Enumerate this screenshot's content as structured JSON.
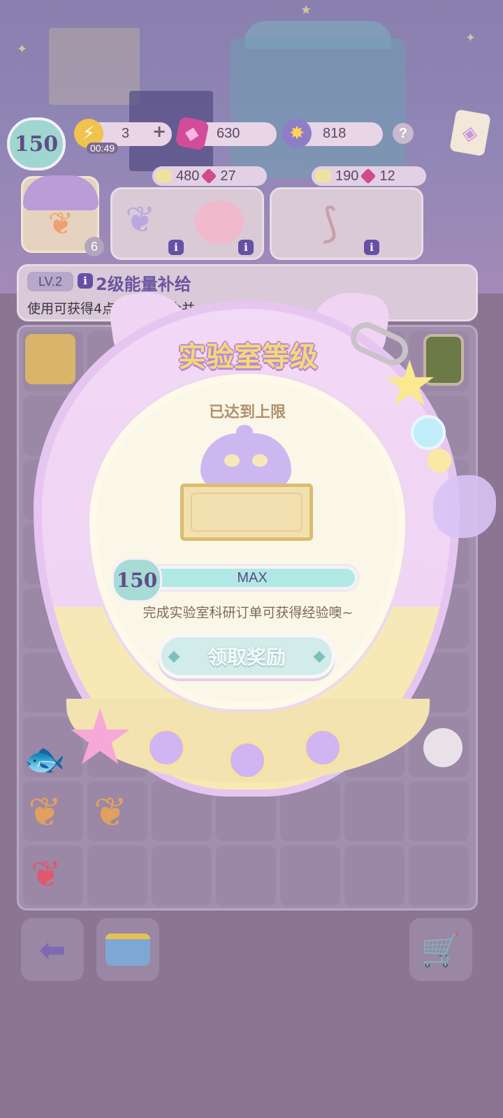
{
  "hud": {
    "level": "150",
    "energy": "3",
    "energy_timer": "00:49",
    "energy_add": "+",
    "gems": "630",
    "stars": "818",
    "help": "?"
  },
  "shop_slots": [
    {
      "ticket": "480",
      "gems": "27"
    },
    {
      "ticket": "190",
      "gems": "12"
    }
  ],
  "selected_item": {
    "count": "6"
  },
  "info_label": "i",
  "description": {
    "level_tag": "LV.2",
    "title": "2级能量补给",
    "text": "使用可获得4点能量值。合并..."
  },
  "popup": {
    "title": "实验室等级",
    "status": "已达到上限",
    "level": "150",
    "progress_label": "MAX",
    "progress_fraction": 1.0,
    "hint": "完成实验室科研订单可获得经验噢~",
    "claim_button": "领取奖励"
  },
  "colors": {
    "accent_purple": "#6650a6",
    "progress_fill": "#b0e8e6",
    "title_gold": "#f4d87a"
  }
}
